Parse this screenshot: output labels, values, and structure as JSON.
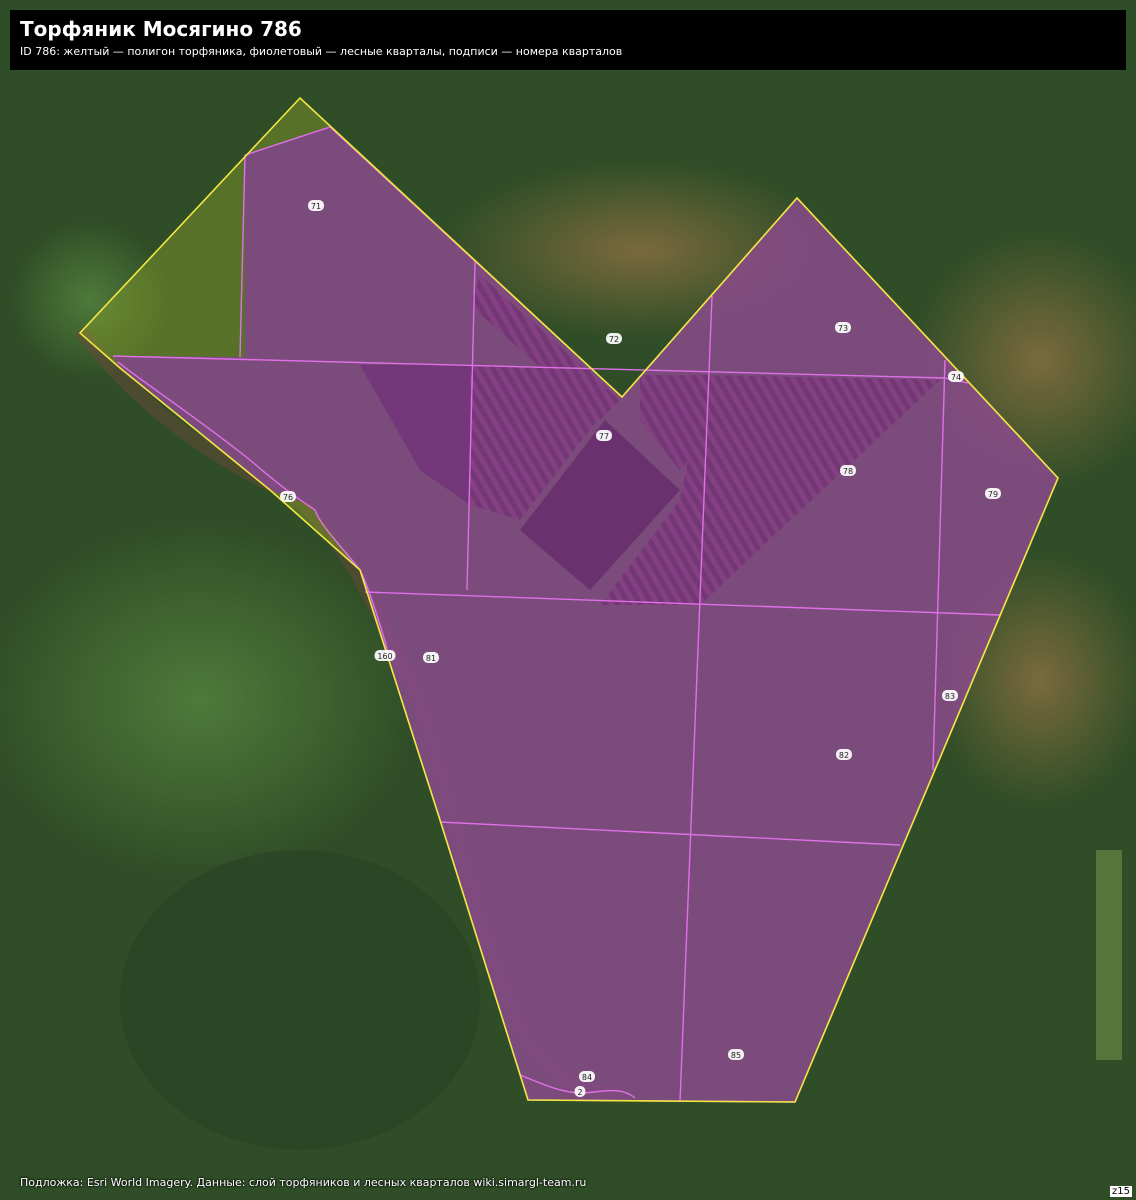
{
  "header": {
    "title": "Торфяник Мосягино 786",
    "subtitle": "ID 786: желтый — полигон торфяника, фиолетовый — лесные кварталы, подписи — номера кварталов"
  },
  "footer": {
    "attribution": "Подложка: Esri World Imagery. Данные: слой торфяников и лесных кварталов wiki.simargl-team.ru",
    "zoom": "z15"
  },
  "legend_colors": {
    "peat_outline": "#f2e640",
    "quarters": "#e070e8",
    "quarter_fill": "#8a3aa0"
  },
  "quarters": [
    "71",
    "72",
    "73",
    "74",
    "76",
    "77",
    "78",
    "79",
    "160",
    "81",
    "83",
    "82",
    "84",
    "85",
    "2"
  ]
}
